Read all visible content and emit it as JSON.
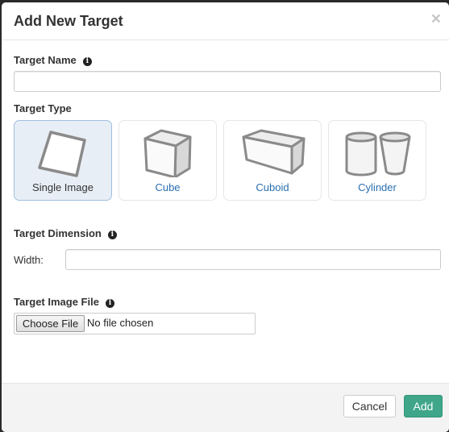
{
  "dialog": {
    "title": "Add New Target",
    "close_glyph": "×"
  },
  "target_name": {
    "label": "Target Name",
    "value": "",
    "placeholder": ""
  },
  "target_type": {
    "label": "Target Type",
    "options": [
      {
        "label": "Single Image",
        "icon": "single-image-icon",
        "selected": true
      },
      {
        "label": "Cube",
        "icon": "cube-icon",
        "selected": false
      },
      {
        "label": "Cuboid",
        "icon": "cuboid-icon",
        "selected": false
      },
      {
        "label": "Cylinder",
        "icon": "cylinder-icon",
        "selected": false
      }
    ]
  },
  "target_dimension": {
    "label": "Target Dimension",
    "width_label": "Width:",
    "width_value": ""
  },
  "target_image_file": {
    "label": "Target Image File",
    "button_label": "Choose File",
    "status": "No file chosen"
  },
  "footer": {
    "cancel_label": "Cancel",
    "add_label": "Add"
  },
  "info_glyph": "i",
  "colors": {
    "accent": "#3fa68a",
    "link": "#2a6fb0",
    "selected_bg": "#e8eef5"
  }
}
